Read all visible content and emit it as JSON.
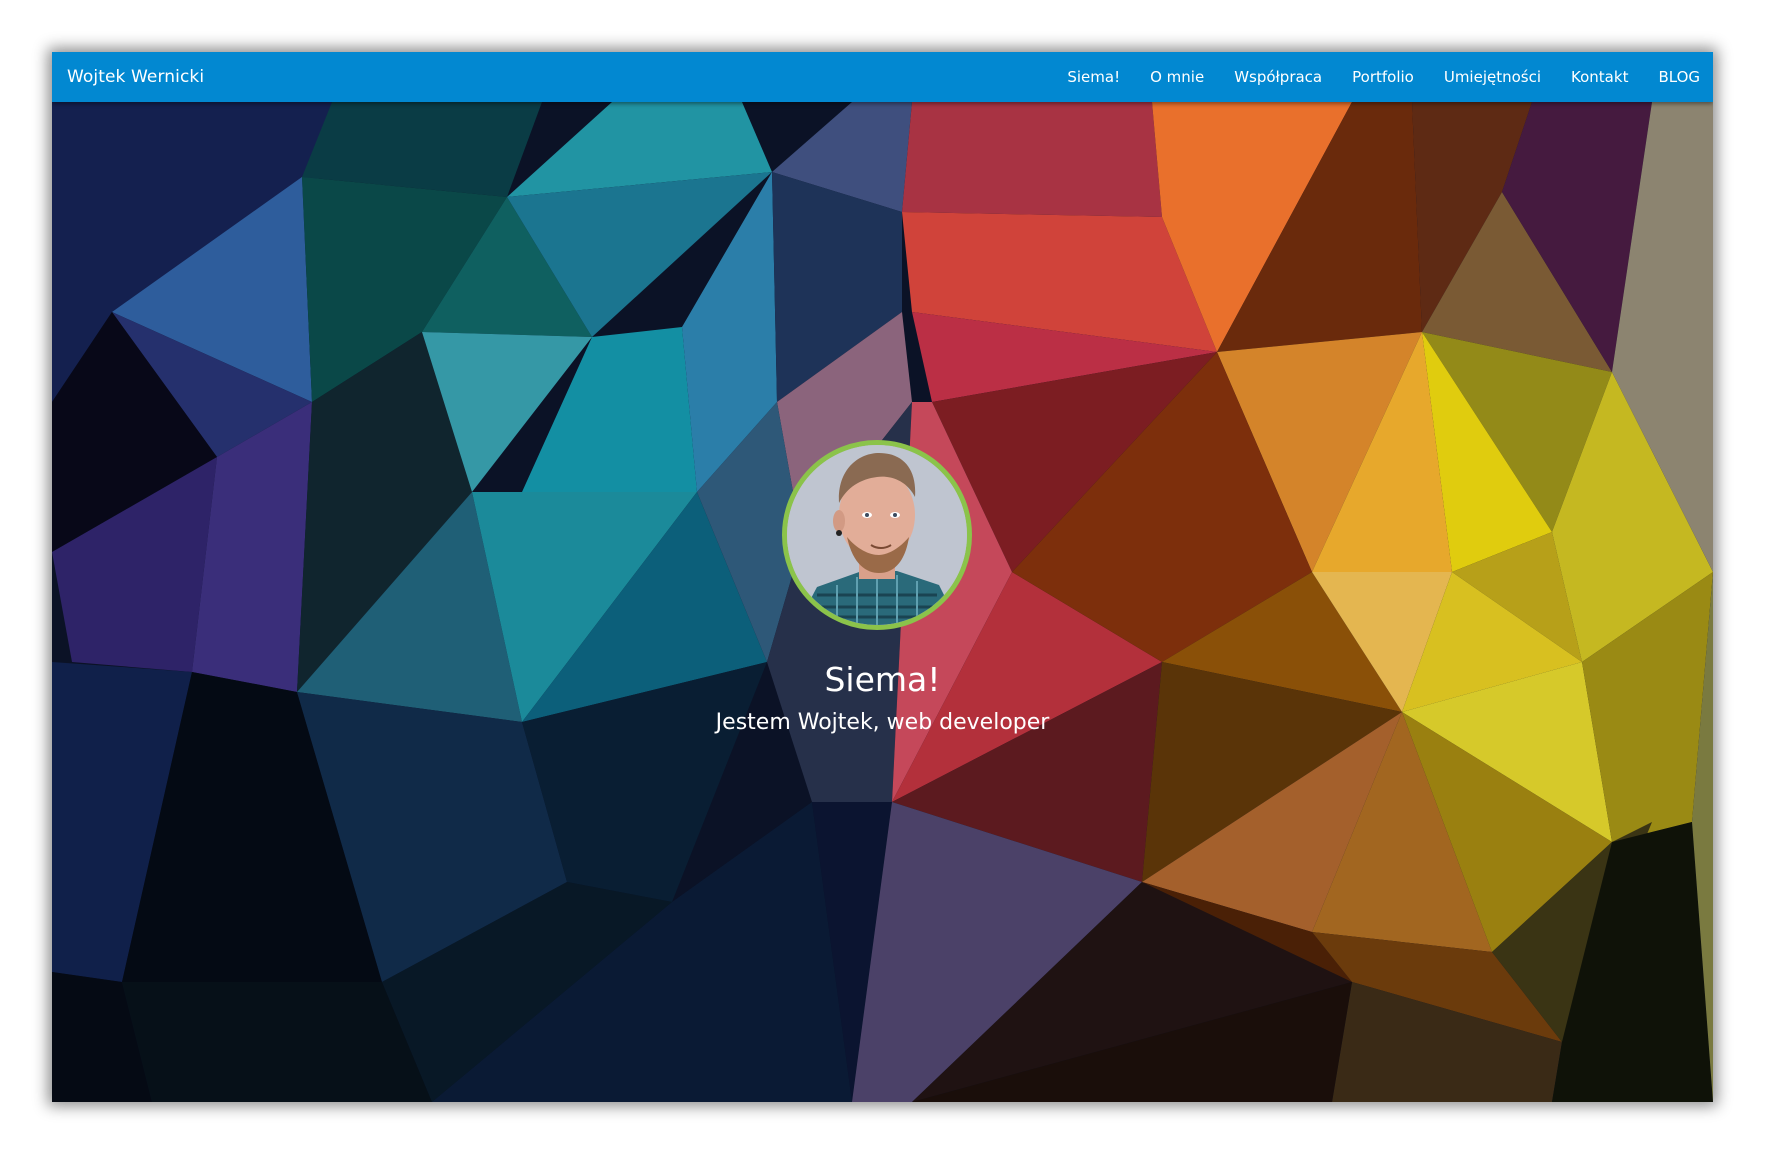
{
  "navbar": {
    "brand": "Wojtek Wernicki",
    "items": [
      "Siema!",
      "O mnie",
      "Współpraca",
      "Portfolio",
      "Umiejętności",
      "Kontakt",
      "BLOG"
    ],
    "background": "#0288d1"
  },
  "hero": {
    "title": "Siema!",
    "subtitle": "Jestem Wojtek, web developer",
    "avatar_icon": "profile-photo",
    "avatar_border_color": "#8bc34a"
  }
}
